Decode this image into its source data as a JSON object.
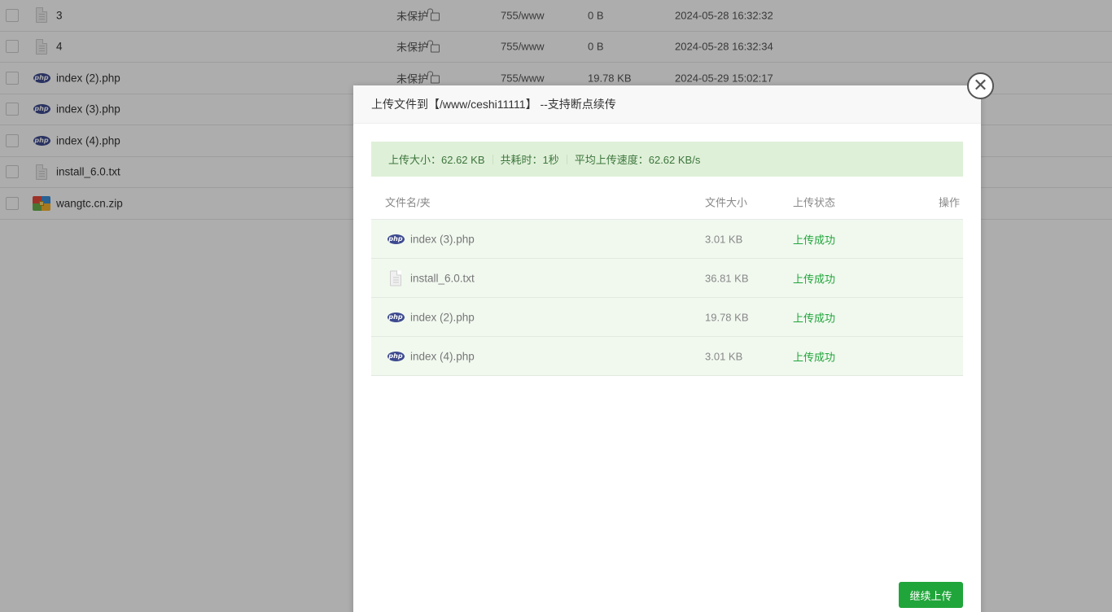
{
  "file_list": {
    "rows": [
      {
        "icon": "text-file-icon",
        "name": "3",
        "protect": "未保护",
        "perm": "755/www",
        "size": "0 B",
        "time": "2024-05-28 16:32:32"
      },
      {
        "icon": "text-file-icon",
        "name": "4",
        "protect": "未保护",
        "perm": "755/www",
        "size": "0 B",
        "time": "2024-05-28 16:32:34"
      },
      {
        "icon": "php-file-icon",
        "name": "index (2).php",
        "protect": "未保护",
        "perm": "755/www",
        "size": "19.78 KB",
        "time": "2024-05-29 15:02:17"
      },
      {
        "icon": "php-file-icon",
        "name": "index (3).php",
        "protect": "",
        "perm": "",
        "size": "",
        "time": ""
      },
      {
        "icon": "php-file-icon",
        "name": "index (4).php",
        "protect": "",
        "perm": "",
        "size": "",
        "time": ""
      },
      {
        "icon": "text-file-icon",
        "name": "install_6.0.txt",
        "protect": "",
        "perm": "",
        "size": "",
        "time": ""
      },
      {
        "icon": "zip-file-icon",
        "name": "wangtc.cn.zip",
        "protect": "",
        "perm": "",
        "size": "",
        "time": ""
      }
    ]
  },
  "dialog": {
    "title": "上传文件到【/www/ceshi11111】 --支持断点续传",
    "summary": {
      "size": "上传大小：62.62 KB",
      "time": "共耗时：1秒",
      "speed": "平均上传速度：62.62 KB/s"
    },
    "table": {
      "headers": {
        "name": "文件名/夹",
        "size": "文件大小",
        "status": "上传状态",
        "op": "操作"
      },
      "rows": [
        {
          "icon": "php-file-icon",
          "name": "index (3).php",
          "size": "3.01 KB",
          "status": "上传成功"
        },
        {
          "icon": "text-file-icon",
          "name": "install_6.0.txt",
          "size": "36.81 KB",
          "status": "上传成功"
        },
        {
          "icon": "php-file-icon",
          "name": "index (2).php",
          "size": "19.78 KB",
          "status": "上传成功"
        },
        {
          "icon": "php-file-icon",
          "name": "index (4).php",
          "size": "3.01 KB",
          "status": "上传成功"
        }
      ]
    },
    "continue_label": "继续上传",
    "close_symbol": "✕"
  },
  "colors": {
    "accent": "#20a53a",
    "summary_bg": "#dff0d8",
    "row_success_bg": "#f1f9ef",
    "php_icon": "#3d4a8f"
  }
}
